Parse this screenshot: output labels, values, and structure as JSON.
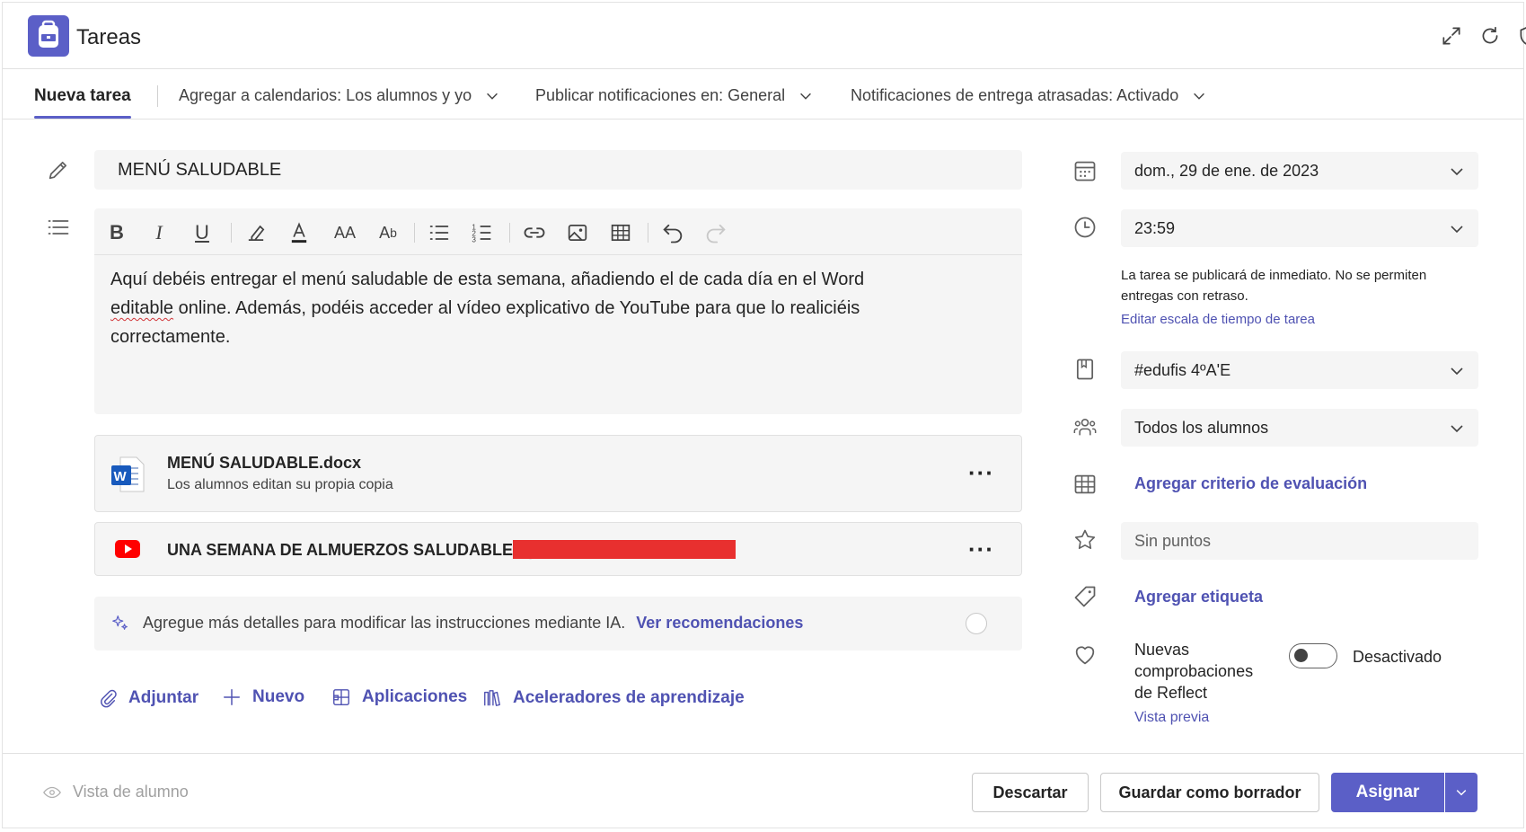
{
  "app": {
    "title": "Tareas"
  },
  "settings_bar": {
    "tab_label": "Nueva tarea",
    "calendars": "Agregar a calendarios: Los alumnos y yo",
    "notifications": "Publicar notificaciones en: General",
    "late_notifications": "Notificaciones de entrega atrasadas: Activado"
  },
  "task": {
    "title": "MENÚ SALUDABLE",
    "instructions_line1": "Aquí debéis entregar el menú saludable de esta semana, añadiendo el de cada día en el Word",
    "instructions_line2_word": "editable",
    "instructions_line2_rest": " online. Además, podéis acceder al vídeo explicativo de YouTube para que lo realiciéis",
    "instructions_line3": "correctamente."
  },
  "attachments": [
    {
      "name": "MENÚ SALUDABLE.docx",
      "subtitle": "Los alumnos editan su propia copia",
      "type": "word"
    },
    {
      "name": "UNA SEMANA DE ALMUERZOS SALUDABLES |",
      "type": "youtube"
    }
  ],
  "ai": {
    "text": "Agregue más detalles para modificar las instrucciones mediante IA.",
    "link": "Ver recomendaciones"
  },
  "actions": {
    "attach": "Adjuntar",
    "new": "Nuevo",
    "apps": "Aplicaciones",
    "accelerators": "Aceleradores de aprendizaje"
  },
  "right": {
    "date": "dom., 29 de ene. de 2023",
    "time": "23:59",
    "schedule_note": "La tarea se publicará de inmediato. No se permiten entregas con retraso.",
    "schedule_link": "Editar escala de tiempo de tarea",
    "class": "#edufis 4ºA'E",
    "students": "Todos los alumnos",
    "rubric_link": "Agregar criterio de evaluación",
    "points_placeholder": "Sin puntos",
    "tag_link": "Agregar etiqueta",
    "reflect_label": "Nuevas comprobaciones de Reflect",
    "reflect_state": "Desactivado",
    "reflect_preview": "Vista previa"
  },
  "footer": {
    "student_view": "Vista de alumno",
    "discard": "Descartar",
    "save_draft": "Guardar como borrador",
    "assign": "Asignar"
  },
  "colors": {
    "accent": "#5b5fc7",
    "link": "#4f52b2",
    "youtube": "#ff0000",
    "word": "#185abd",
    "redaction": "#e8302f"
  }
}
